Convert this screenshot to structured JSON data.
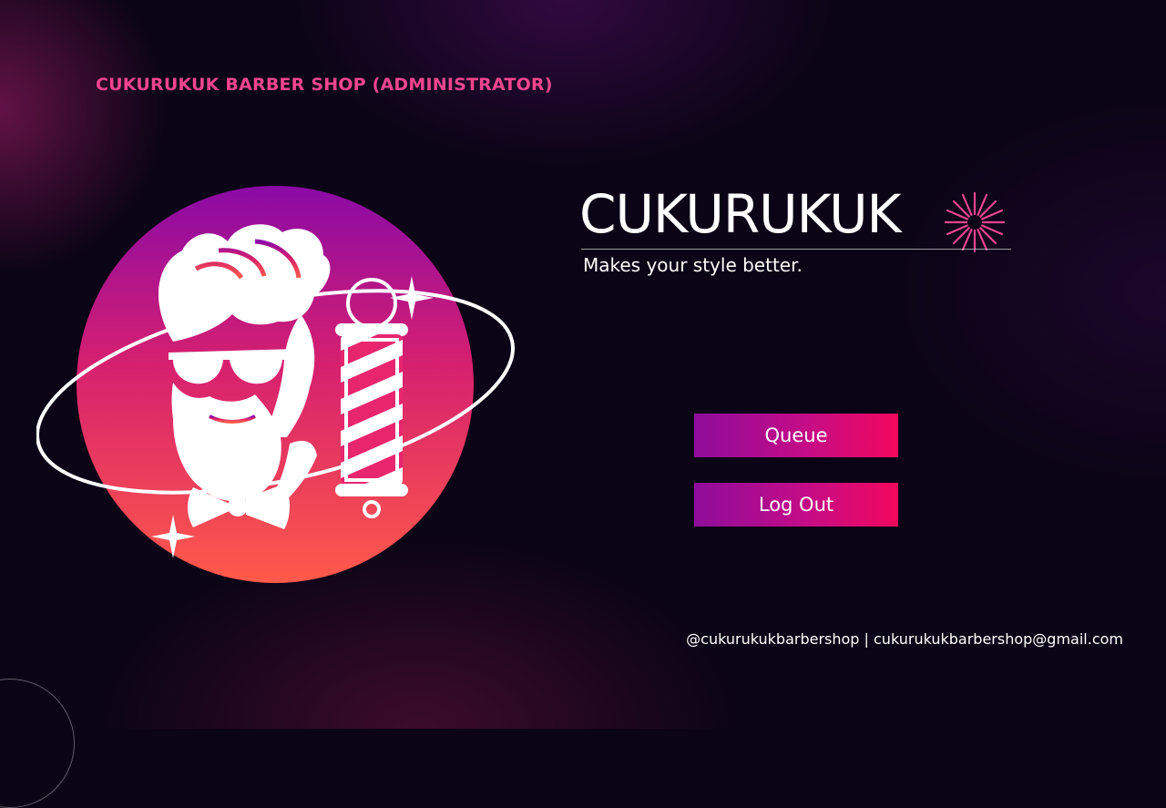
{
  "header": {
    "title": "CUKURUKUK BARBER SHOP (ADMINISTRATOR)"
  },
  "brand": {
    "name": "CUKURUKUK",
    "tagline": "Makes your style better."
  },
  "actions": {
    "queue_label": "Queue",
    "logout_label": "Log Out"
  },
  "footer": {
    "contact": "@cukurukukbarbershop | cukurukukbarbershop@gmail.com"
  },
  "icons": {
    "logo": "barber-logo-icon",
    "pole": "barber-pole-icon",
    "sparkle": "sparkle-icon",
    "starburst": "starburst-icon"
  },
  "colors": {
    "accent": "#f0458f",
    "button_start": "#8e0d9b",
    "button_end": "#f3085d",
    "background": "#0b0416",
    "circle_top": "#8a0aa6",
    "circle_bottom": "#ff5a4a"
  }
}
